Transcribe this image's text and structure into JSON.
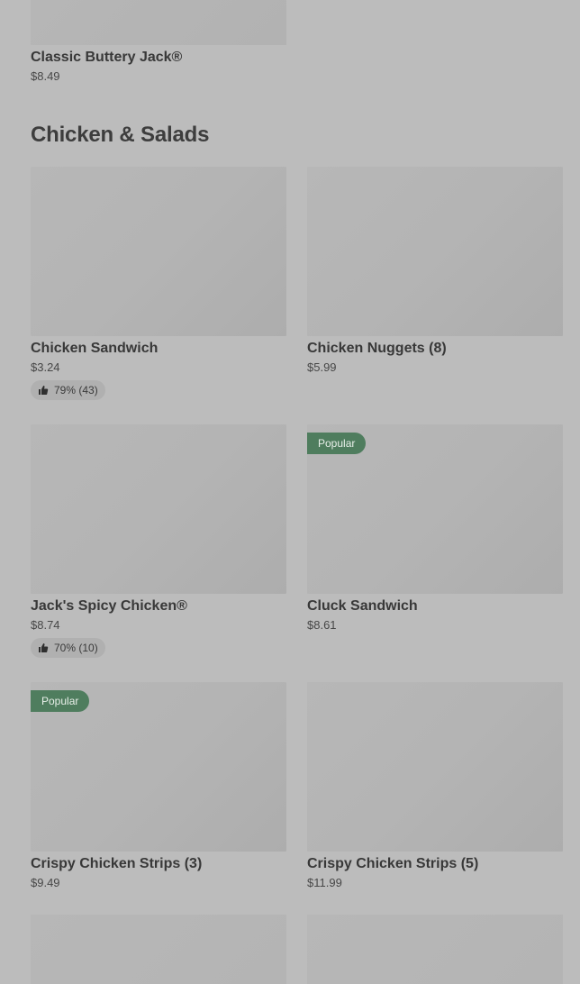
{
  "top_item": {
    "name": "Classic Buttery Jack®",
    "price": "$8.49"
  },
  "section": {
    "title": "Chicken & Salads"
  },
  "items": [
    {
      "name": "Chicken Sandwich",
      "price": "$3.24",
      "rating": "79% (43)",
      "badge": ""
    },
    {
      "name": "Chicken Nuggets (8)",
      "price": "$5.99",
      "rating": "",
      "badge": ""
    },
    {
      "name": "Jack's Spicy Chicken®",
      "price": "$8.74",
      "rating": "70% (10)",
      "badge": ""
    },
    {
      "name": "Cluck Sandwich",
      "price": "$8.61",
      "rating": "",
      "badge": "Popular"
    },
    {
      "name": "Crispy Chicken Strips (3)",
      "price": "$9.49",
      "rating": "",
      "badge": "Popular"
    },
    {
      "name": "Crispy Chicken Strips (5)",
      "price": "$11.99",
      "rating": "",
      "badge": ""
    }
  ],
  "colors": {
    "background": "#bcbcbc",
    "badge": "#4f7d5e"
  },
  "icons": {
    "rating": "thumbs-up-icon"
  }
}
